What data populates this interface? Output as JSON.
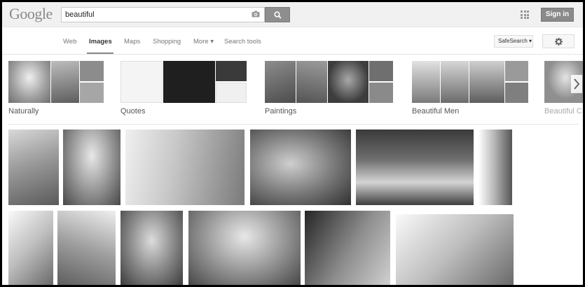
{
  "header": {
    "logo": "Google",
    "search_value": "beautiful",
    "signin_label": "Sign in",
    "icons": {
      "camera": "camera-icon",
      "search": "magnifier-icon",
      "apps": "apps-grid-icon"
    }
  },
  "nav": {
    "items": [
      "Web",
      "Images",
      "Maps",
      "Shopping",
      "More ▾",
      "Search tools"
    ],
    "active": "Images",
    "safesearch_label": "SafeSearch ▾",
    "icons": {
      "settings": "gear-icon"
    }
  },
  "related": [
    {
      "label": "Naturally"
    },
    {
      "label": "Quotes"
    },
    {
      "label": "Paintings"
    },
    {
      "label": "Beautiful Men"
    },
    {
      "label": "Beautiful C"
    }
  ],
  "colors": {
    "header_bg": "#f1f1f1",
    "button_gray": "#8e8e8e",
    "active_nav": "#333333"
  }
}
